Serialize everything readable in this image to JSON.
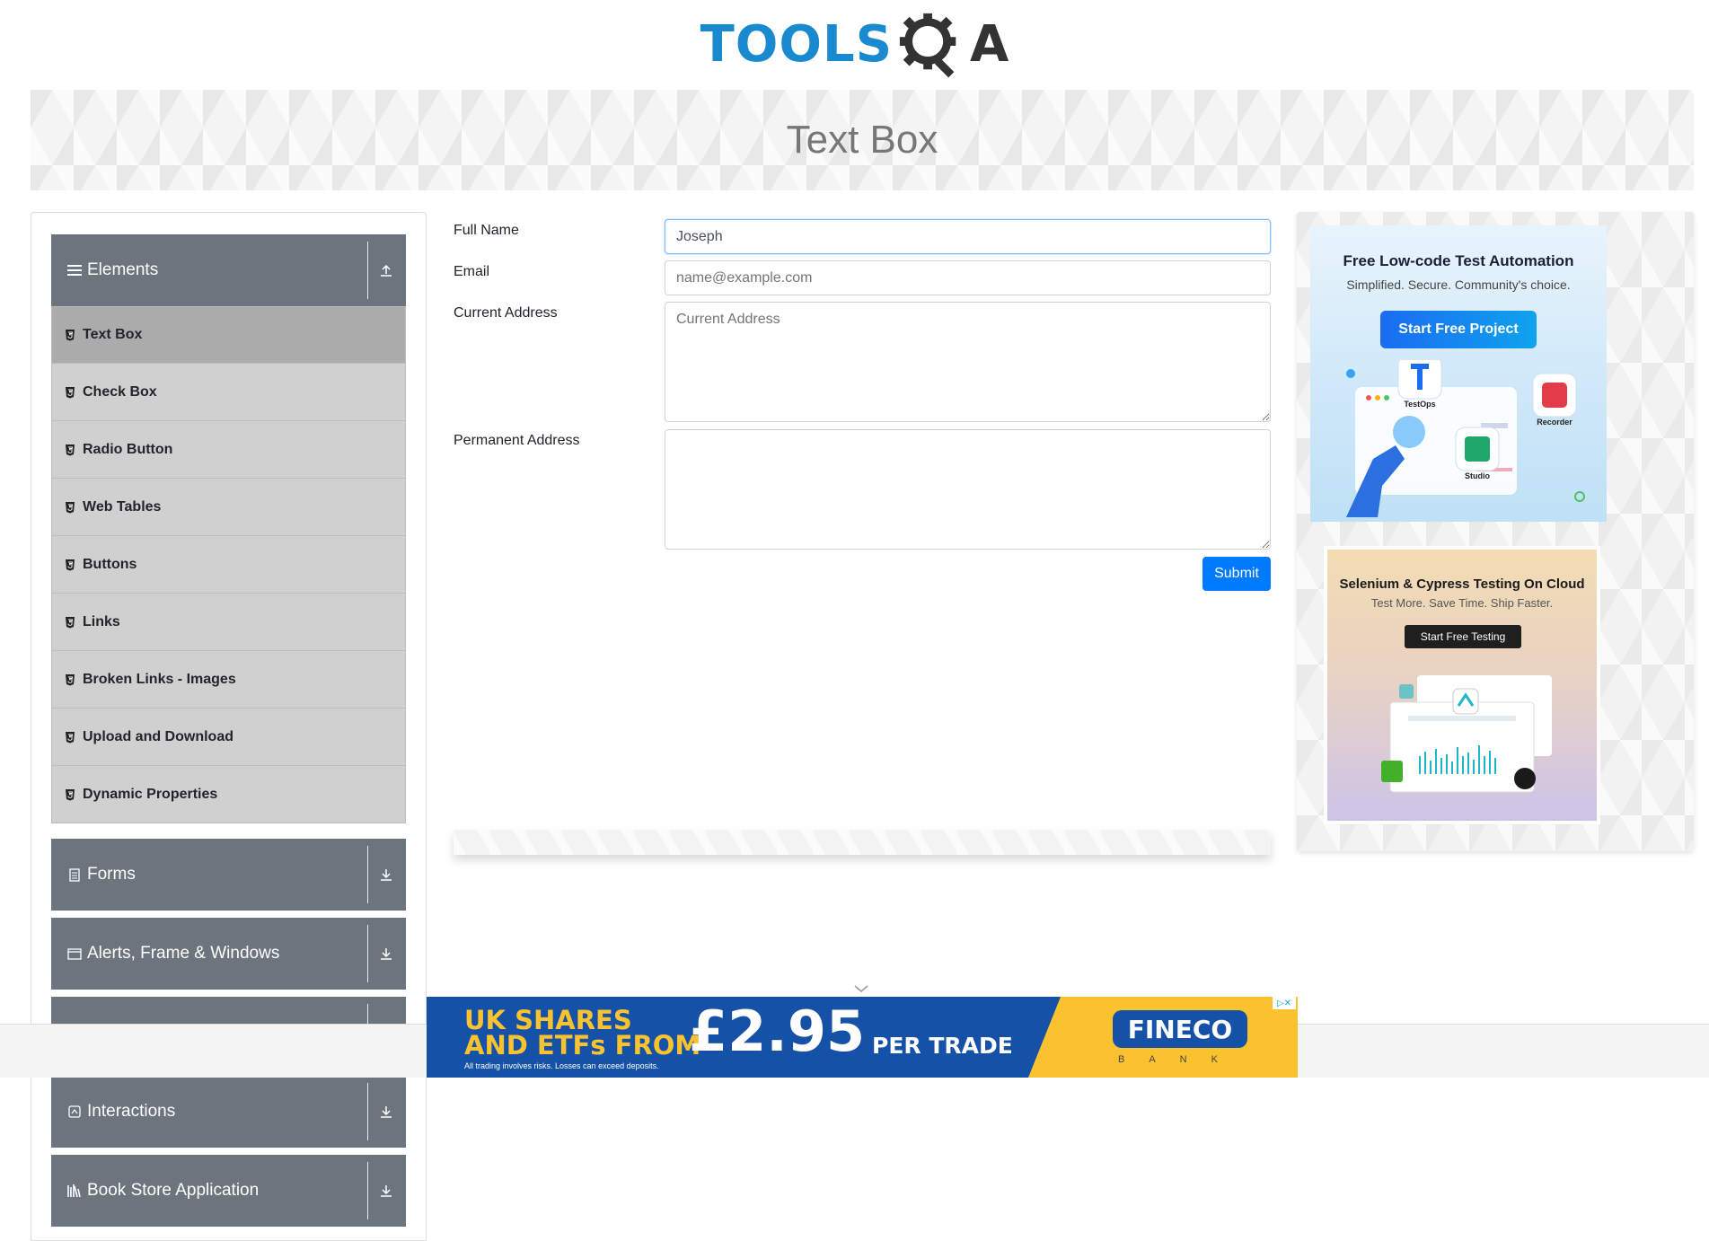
{
  "header": {
    "logo_text": "TOOLS",
    "logo_letter": "A",
    "brand_color": "#1a8ad0"
  },
  "banner": {
    "title": "Text Box"
  },
  "sidebar": {
    "groups": [
      {
        "label": "Elements",
        "icon": "hamburger-icon",
        "arrow": "collapse-up-icon"
      },
      {
        "label": "Forms",
        "icon": "document-icon",
        "arrow": "expand-down-icon"
      },
      {
        "label": "Alerts, Frame & Windows",
        "icon": "window-icon",
        "arrow": "expand-down-icon"
      },
      {
        "label": "Interactions",
        "icon": "interaction-icon",
        "arrow": "expand-down-icon"
      },
      {
        "label": "Book Store Application",
        "icon": "books-icon",
        "arrow": "expand-down-icon"
      }
    ],
    "items": [
      {
        "label": "Text Box",
        "active": true
      },
      {
        "label": "Check Box"
      },
      {
        "label": "Radio Button"
      },
      {
        "label": "Web Tables"
      },
      {
        "label": "Buttons"
      },
      {
        "label": "Links"
      },
      {
        "label": "Broken Links - Images"
      },
      {
        "label": "Upload and Download"
      },
      {
        "label": "Dynamic Properties"
      }
    ],
    "header_color": "#6c757d",
    "item_color": "#d0d0d0",
    "active_item_color": "#ababab"
  },
  "form": {
    "full_name": {
      "label": "Full Name",
      "value": "Joseph",
      "placeholder": "Full Name"
    },
    "email": {
      "label": "Email",
      "value": "",
      "placeholder": "name@example.com"
    },
    "current_address": {
      "label": "Current Address",
      "value": "",
      "placeholder": "Current Address"
    },
    "permanent_address": {
      "label": "Permanent Address",
      "value": "",
      "placeholder": ""
    },
    "submit_label": "Submit",
    "submit_color": "#007bff"
  },
  "ads": {
    "ad1": {
      "title": "Free Low-code Test Automation",
      "subtitle": "Simplified. Secure. Community's choice.",
      "button": "Start Free Project",
      "apps": [
        "TestOps",
        "Recorder",
        "Studio"
      ]
    },
    "ad2": {
      "title": "Selenium & Cypress Testing On Cloud",
      "subtitle": "Test More. Save Time. Ship Faster.",
      "button": "Start Free Testing"
    },
    "bottom": {
      "line1": "UK SHARES",
      "line2": "AND ETFs FROM",
      "price": "£2.95",
      "per": "PER TRADE",
      "disclaimer": "All trading involves risks. Losses can exceed deposits.",
      "brand": "FINECO",
      "brand_sub": "BANK",
      "adchoices": "▷✕"
    }
  }
}
